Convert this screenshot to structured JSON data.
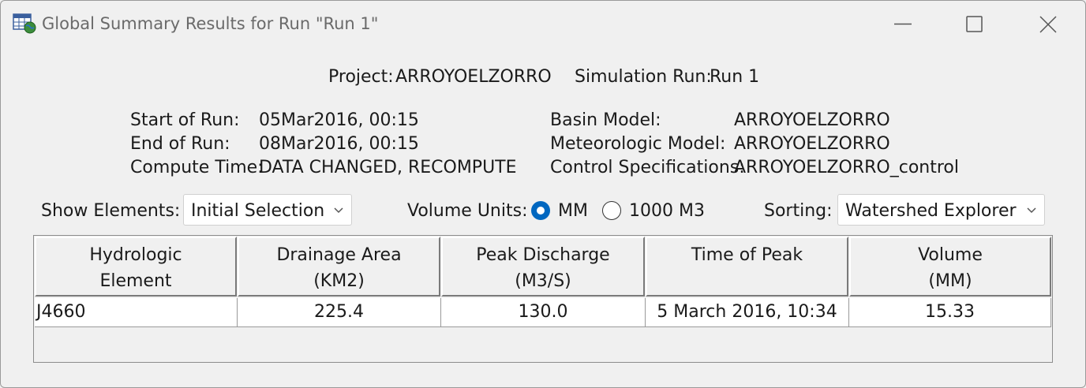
{
  "window": {
    "title": "Global Summary Results for Run \"Run 1\""
  },
  "header": {
    "project_label": "Project:",
    "project_value": "ARROYOELZORRO",
    "simulation_label": "Simulation Run:",
    "simulation_value": "Run 1"
  },
  "run_info": {
    "start_label": "Start of Run:",
    "start_value": "05Mar2016, 00:15",
    "end_label": "End of Run:",
    "end_value": "08Mar2016, 00:15",
    "compute_label": "Compute Time:",
    "compute_value": "DATA CHANGED, RECOMPUTE",
    "basin_label": "Basin Model:",
    "basin_value": "ARROYOELZORRO",
    "met_label": "Meteorologic Model:",
    "met_value": "ARROYOELZORRO",
    "control_label": "Control Specifications:",
    "control_value": "ARROYOELZORRO_control"
  },
  "controls": {
    "show_elements_label": "Show Elements:",
    "show_elements_value": "Initial Selection",
    "volume_units_label": "Volume Units:",
    "unit_mm_label": "MM",
    "unit_1000m3_label": "1000 M3",
    "selected_unit": "MM",
    "sorting_label": "Sorting:",
    "sorting_value": "Watershed Explorer"
  },
  "table": {
    "columns": [
      {
        "line1": "Hydrologic",
        "line2": "Element"
      },
      {
        "line1": "Drainage Area",
        "line2": "(KM2)"
      },
      {
        "line1": "Peak Discharge",
        "line2": "(M3/S)"
      },
      {
        "line1": "Time of Peak",
        "line2": ""
      },
      {
        "line1": "Volume",
        "line2": "(MM)"
      }
    ],
    "rows": [
      [
        "J4660",
        "225.4",
        "130.0",
        "5 March 2016, 10:34",
        "15.33"
      ]
    ]
  },
  "icons": {
    "app": "table-globe-icon",
    "minimize": "minimize-icon",
    "maximize": "maximize-icon",
    "close": "close-icon"
  },
  "colors": {
    "accent": "#0067c0"
  }
}
